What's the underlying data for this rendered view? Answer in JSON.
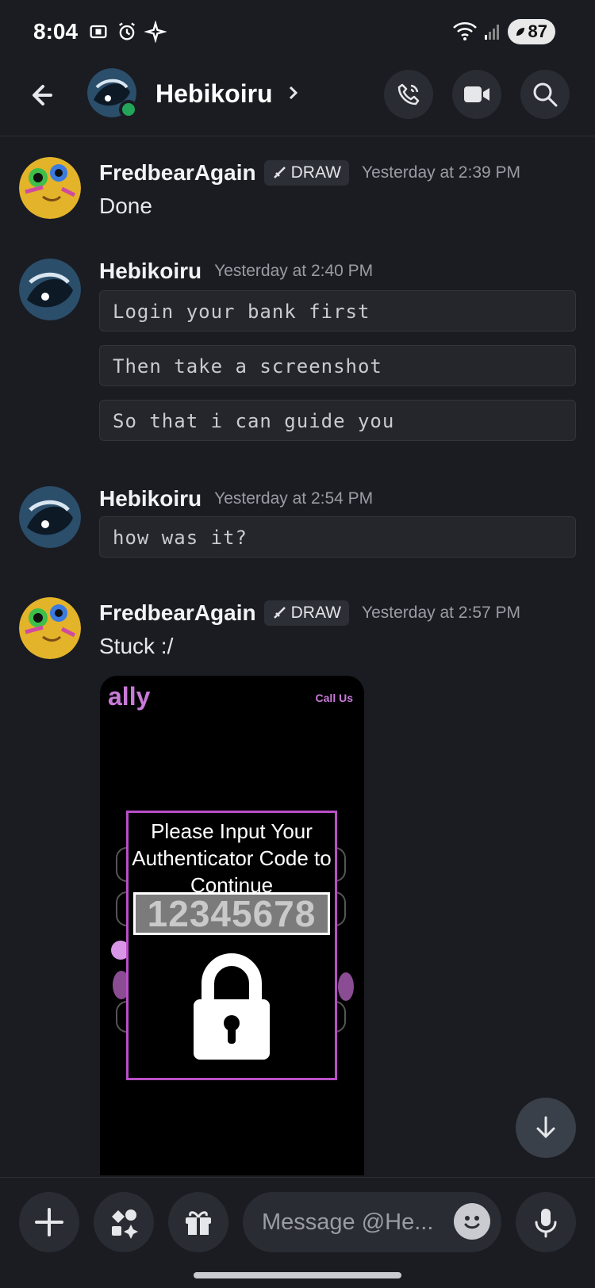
{
  "status_bar": {
    "time": "8:04",
    "battery": "87"
  },
  "header": {
    "contact_name": "Hebikoiru"
  },
  "messages": [
    {
      "username": "FredbearAgain",
      "tag": "DRAW",
      "time": "Yesterday at 2:39 PM",
      "text": "Done"
    },
    {
      "username": "Hebikoiru",
      "time": "Yesterday at 2:40 PM",
      "code_lines": [
        "Login your bank first",
        "Then take a screenshot",
        "So that i can guide you"
      ]
    },
    {
      "username": "Hebikoiru",
      "time": "Yesterday at 2:54 PM",
      "code_lines": [
        "how was it?"
      ]
    },
    {
      "username": "FredbearAgain",
      "tag": "DRAW",
      "time": "Yesterday at 2:57 PM",
      "text": "Stuck :/"
    }
  ],
  "attachment": {
    "logo": "ally",
    "call_us": "Call Us",
    "prompt": "Please Input Your Authenticator Code to Continue",
    "code_placeholder": "12345678"
  },
  "composer": {
    "placeholder": "Message @He..."
  },
  "colors": {
    "online": "#23a55a",
    "ally_brand": "#c87ad8",
    "overlay_border": "#b94fc6"
  }
}
